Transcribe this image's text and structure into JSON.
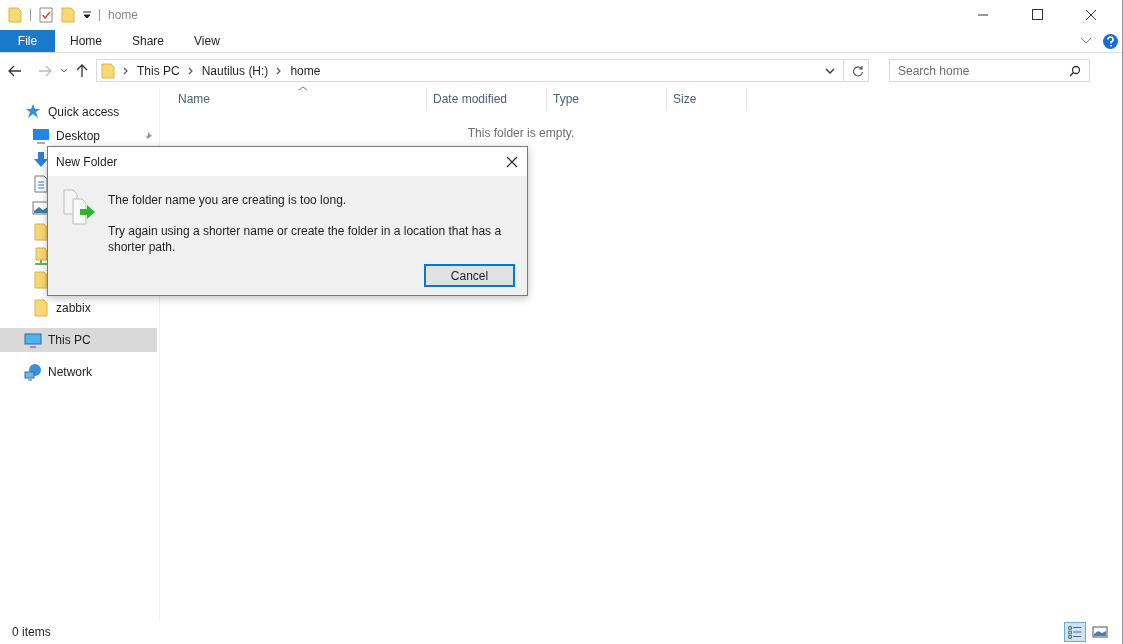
{
  "window": {
    "title": "home"
  },
  "ribbon_tabs": [
    {
      "label": "File",
      "selected": true
    },
    {
      "label": "Home",
      "selected": false
    },
    {
      "label": "Share",
      "selected": false
    },
    {
      "label": "View",
      "selected": false
    }
  ],
  "address_bar": {
    "crumbs": [
      "This PC",
      "Nautilus (H:)",
      "home"
    ]
  },
  "search": {
    "placeholder": "Search home"
  },
  "sidebar": {
    "items": [
      {
        "kind": "star",
        "label": "Quick access",
        "selected": false
      },
      {
        "kind": "desktop",
        "label": "Desktop",
        "selected": false,
        "pinned": true
      },
      {
        "kind": "download",
        "selected": false
      },
      {
        "kind": "document",
        "selected": false
      },
      {
        "kind": "image",
        "selected": false
      },
      {
        "kind": "folder",
        "selected": false
      },
      {
        "kind": "netfolder",
        "selected": false
      },
      {
        "kind": "folder",
        "selected": false
      },
      {
        "kind": "folder",
        "label": "zabbix",
        "selected": false
      },
      {
        "kind": "pc",
        "label": "This PC",
        "selected": true
      },
      {
        "kind": "network",
        "label": "Network",
        "selected": false
      }
    ]
  },
  "columns": [
    "Name",
    "Date modified",
    "Type",
    "Size"
  ],
  "empty_message": "This folder is empty.",
  "dialog": {
    "title": "New Folder",
    "message": "The folder name you are creating is too long.",
    "detail": "Try again using a shorter name or create the folder in a location that has a shorter path.",
    "button": "Cancel"
  },
  "status_bar": {
    "count": "0 items"
  }
}
